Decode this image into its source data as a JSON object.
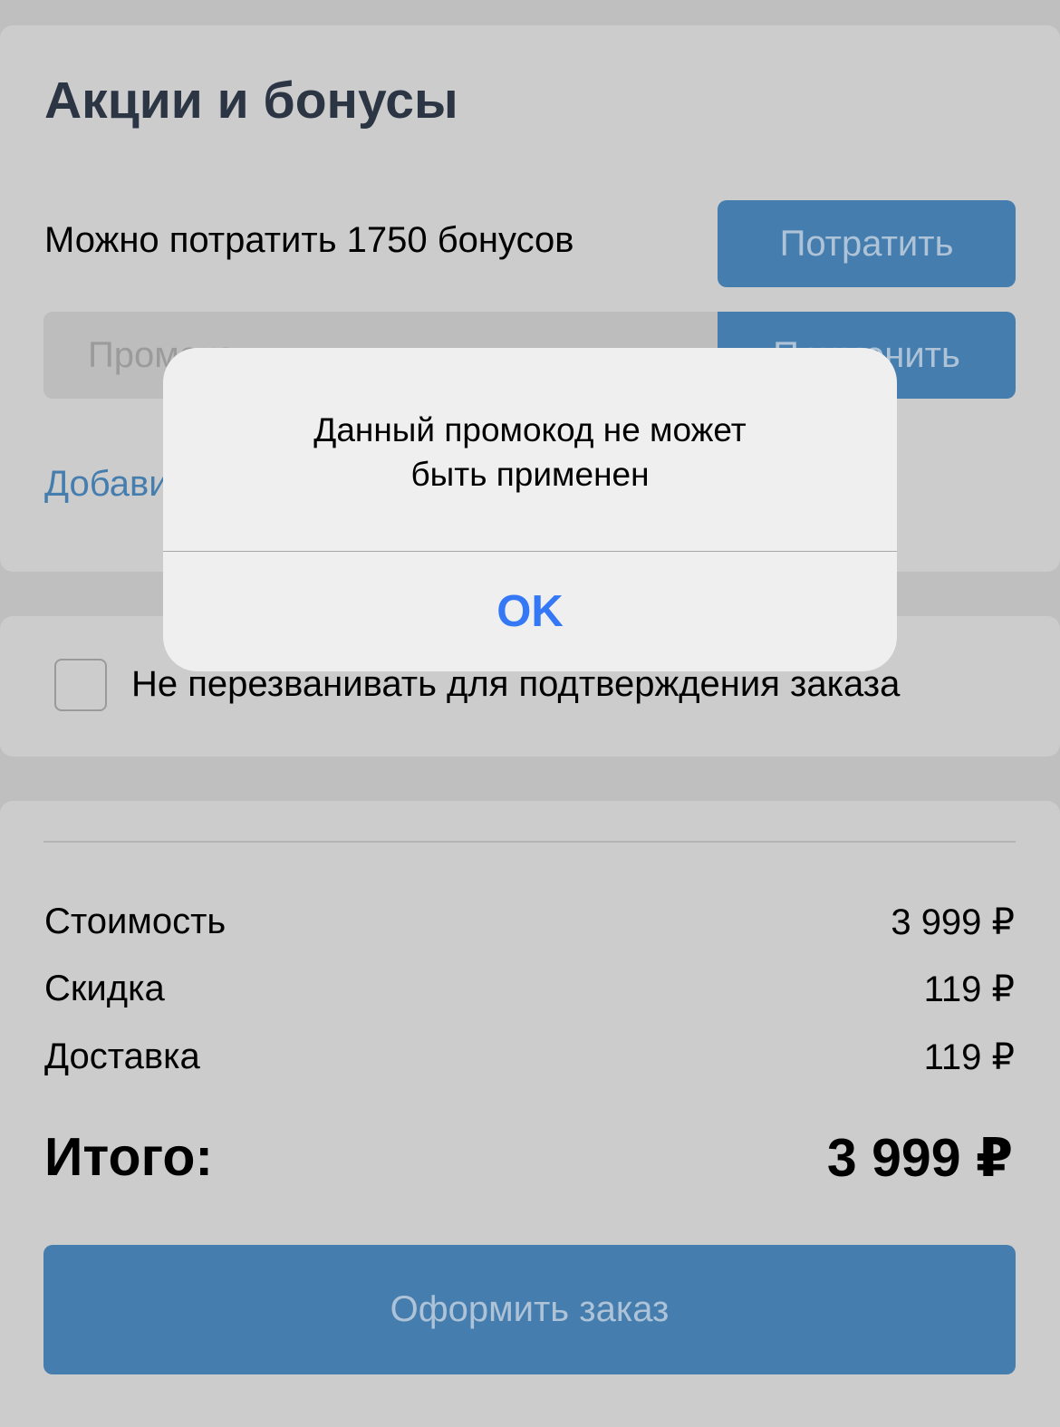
{
  "promo_section": {
    "title": "Акции и бонусы",
    "bonus_text": "Можно потратить 1750 бонусов",
    "spend_button": "Потратить",
    "promo_placeholder": "Промокод",
    "promo_value": "",
    "apply_button": "Применить",
    "add_link": "Добавить"
  },
  "callback": {
    "checked": false,
    "label": "Не перезванивать для подтверждения заказа"
  },
  "summary": {
    "rows": [
      {
        "label": "Стоимость",
        "value": "3 999 ₽"
      },
      {
        "label": "Скидка",
        "value": "119 ₽"
      },
      {
        "label": "Доставка",
        "value": "119 ₽"
      }
    ],
    "total_label": "Итого:",
    "total_value": "3 999 ₽",
    "order_button": "Оформить заказ"
  },
  "alert": {
    "message": "Данный промокод не может\nбыть применен",
    "ok_button": "OK"
  },
  "colors": {
    "accent": "#457eae",
    "alert_button": "#3478f6",
    "overlay_background": "#cccccc"
  }
}
